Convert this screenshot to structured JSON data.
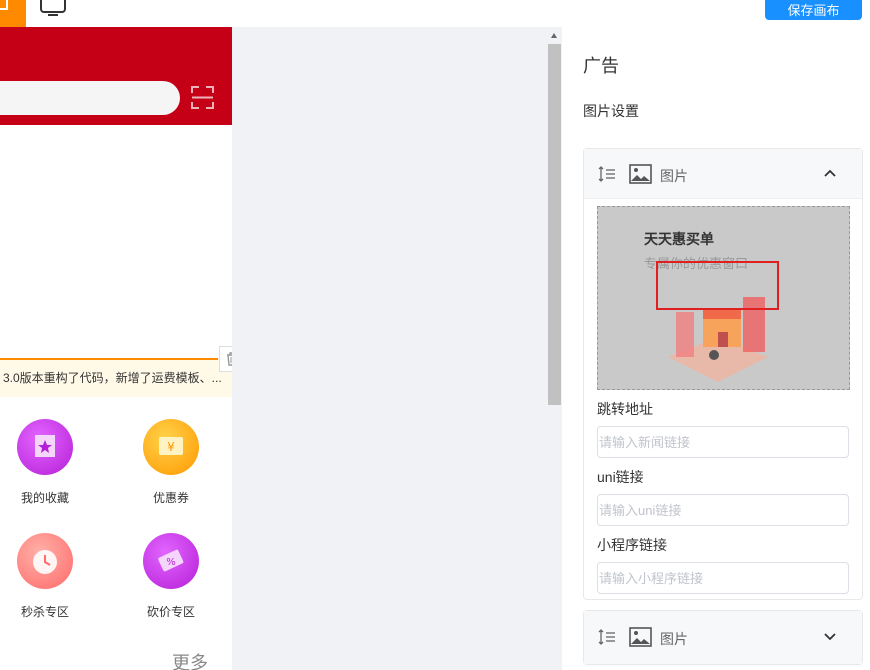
{
  "toolbar": {
    "save_label": "保存画布"
  },
  "phone": {
    "notice_text": "3.0版本重构了代码，新增了运费模板、...",
    "grid": [
      {
        "label": "我的收藏",
        "icon": "favorites-icon",
        "color": "#c72ee8"
      },
      {
        "label": "优惠券",
        "icon": "coupon-icon",
        "color": "#ffa000"
      },
      {
        "label": "秒杀专区",
        "icon": "alarm-clock-icon",
        "color": "#ff7b7b"
      },
      {
        "label": "砍价专区",
        "icon": "bargain-ticket-icon",
        "color": "#c72ee8"
      }
    ],
    "more_label": "更多"
  },
  "panel": {
    "title": "广告",
    "subtitle": "图片设置",
    "card1": {
      "label": "图片",
      "image_title": "天天惠买单",
      "image_subtitle": "专属你的优惠窗口",
      "fields": [
        {
          "label": "跳转地址",
          "placeholder": "请输入新闻链接"
        },
        {
          "label": "uni链接",
          "placeholder": "请输入uni链接"
        },
        {
          "label": "小程序链接",
          "placeholder": "请输入小程序链接"
        }
      ]
    },
    "card2": {
      "label": "图片"
    }
  },
  "colors": {
    "header_red": "#c50016",
    "accent_blue": "#1890ff",
    "accent_orange": "#ff8a00"
  }
}
